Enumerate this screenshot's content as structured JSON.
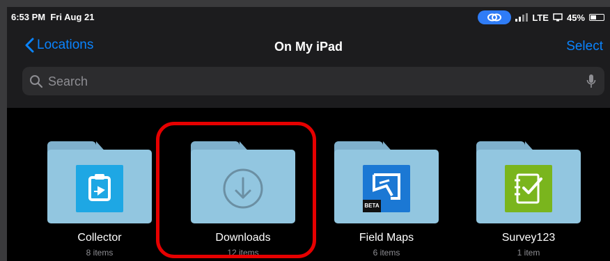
{
  "status_bar": {
    "time": "6:53 PM",
    "date": "Fri Aug 21",
    "network": "LTE",
    "battery": "45%",
    "battery_level": 0.45
  },
  "nav": {
    "back_label": "Locations",
    "title": "On My iPad",
    "select_label": "Select"
  },
  "search": {
    "placeholder": "Search",
    "value": ""
  },
  "folders": [
    {
      "name": "Collector",
      "count": "8 items",
      "icon": "collector-app-icon"
    },
    {
      "name": "Downloads",
      "count": "12 items",
      "icon": "download-arrow-icon"
    },
    {
      "name": "Field Maps",
      "count": "6 items",
      "icon": "field-maps-app-icon",
      "badge": "BETA"
    },
    {
      "name": "Survey123",
      "count": "1 item",
      "icon": "survey123-app-icon"
    }
  ],
  "colors": {
    "accent": "#0a84ff",
    "highlight": "#e60000",
    "folder": "#92c6e0",
    "collector": "#1ea7e4",
    "field_maps": "#1b78d4",
    "survey123": "#7ab51d"
  }
}
